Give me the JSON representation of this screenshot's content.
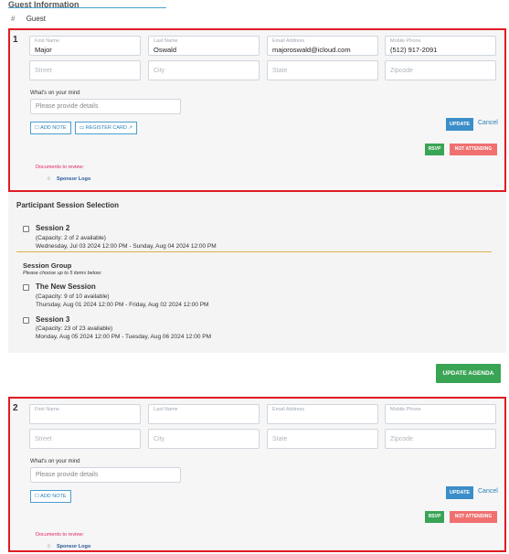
{
  "section_title": "Guest Information",
  "guest_label": "Guest",
  "hash_symbol": "#",
  "guests": [
    {
      "number": "1",
      "first_name": {
        "label": "First Name",
        "value": "Major"
      },
      "last_name": {
        "label": "Last Name",
        "value": "Oswald"
      },
      "email": {
        "label": "Email Address",
        "value": "majoroswald@icloud.com"
      },
      "phone": {
        "label": "Mobile Phone",
        "value": "(512) 917-2091"
      },
      "street_placeholder": "Street",
      "city_placeholder": "City",
      "state_placeholder": "State",
      "zip_placeholder": "Zipcode",
      "mind_label": "What's on your mind",
      "mind_placeholder": "Please provide details",
      "add_note": "ADD NOTE",
      "register_card": "REGISTER CARD",
      "update": "UPDATE",
      "cancel": "Cancel",
      "rsvp": "RSVP",
      "not_attending": "NOT ATTENDING",
      "docs_label": "Documents to review:",
      "doc_item": "Sponsor Logo"
    },
    {
      "number": "2",
      "first_name": {
        "label": "First Name",
        "value": ""
      },
      "last_name": {
        "label": "Last Name",
        "value": ""
      },
      "email": {
        "label": "Email Address",
        "value": ""
      },
      "phone": {
        "label": "Mobile Phone",
        "value": ""
      },
      "street_placeholder": "Street",
      "city_placeholder": "City",
      "state_placeholder": "State",
      "zip_placeholder": "Zipcode",
      "mind_label": "What's on your mind",
      "mind_placeholder": "Please provide details",
      "add_note": "ADD NOTE",
      "update": "UPDATE",
      "cancel": "Cancel",
      "rsvp": "RSVP",
      "not_attending": "NOT ATTENDING",
      "docs_label": "Documents to review:",
      "doc_item": "Sponsor Logo"
    }
  ],
  "sessions": {
    "title": "Participant Session Selection",
    "session2": {
      "name": "Session 2",
      "capacity": "(Capacity: 2 of 2 available)",
      "dates": "Wednesday, Jul 03 2024 12:00 PM - Sunday, Aug 04 2024 12:00 PM"
    },
    "group_title": "Session Group",
    "group_sub": "Please choose up to 5 items below:",
    "new_session": {
      "name": "The New Session",
      "capacity": "(Capacity: 9 of 10 available)",
      "dates": "Thursday, Aug 01 2024 12:00 PM - Friday, Aug 02 2024 12:00 PM"
    },
    "session3": {
      "name": "Session 3",
      "capacity": "(Capacity: 23 of 23 available)",
      "dates": "Monday, Aug 05 2024 12:00 PM - Tuesday, Aug 06 2024 12:00 PM"
    }
  },
  "update_agenda": "UPDATE AGENDA",
  "colors": {
    "border_red": "#e01b24",
    "green": "#3aa455",
    "blue": "#3b8ec9",
    "pink": "#f07070"
  }
}
